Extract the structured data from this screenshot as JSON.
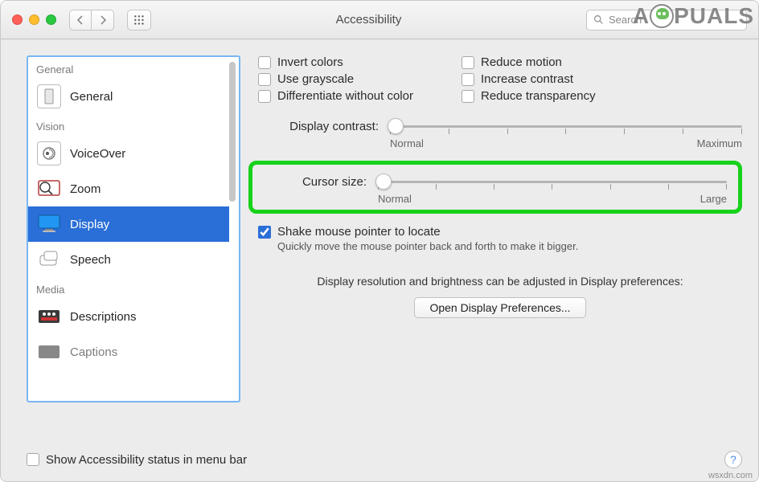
{
  "window": {
    "title": "Accessibility"
  },
  "search": {
    "placeholder": "Search"
  },
  "sidebar": {
    "sections": [
      {
        "label": "General",
        "items": [
          {
            "label": "General"
          }
        ]
      },
      {
        "label": "Vision",
        "items": [
          {
            "label": "VoiceOver"
          },
          {
            "label": "Zoom"
          },
          {
            "label": "Display",
            "selected": true
          },
          {
            "label": "Speech"
          }
        ]
      },
      {
        "label": "Media",
        "items": [
          {
            "label": "Descriptions"
          },
          {
            "label": "Captions"
          }
        ]
      }
    ]
  },
  "options": {
    "left": [
      {
        "key": "invert_colors",
        "label": "Invert colors",
        "checked": false
      },
      {
        "key": "use_grayscale",
        "label": "Use grayscale",
        "checked": false
      },
      {
        "key": "diff_without_color",
        "label": "Differentiate without color",
        "checked": false
      }
    ],
    "right": [
      {
        "key": "reduce_motion",
        "label": "Reduce motion",
        "checked": false
      },
      {
        "key": "increase_contrast",
        "label": "Increase contrast",
        "checked": false
      },
      {
        "key": "reduce_transparency",
        "label": "Reduce transparency",
        "checked": false
      }
    ]
  },
  "sliders": {
    "contrast": {
      "label": "Display contrast:",
      "min_label": "Normal",
      "max_label": "Maximum"
    },
    "cursor": {
      "label": "Cursor size:",
      "min_label": "Normal",
      "max_label": "Large"
    }
  },
  "shake": {
    "label": "Shake mouse pointer to locate",
    "checked": true,
    "hint": "Quickly move the mouse pointer back and forth to make it bigger."
  },
  "resolution_note": "Display resolution and brightness can be adjusted in Display preferences:",
  "open_display_btn": "Open Display Preferences...",
  "footer": {
    "show_status": "Show Accessibility status in menu bar",
    "checked": false
  },
  "watermark": {
    "pre": "A",
    "post": "PUALS"
  },
  "source": "wsxdn.com"
}
